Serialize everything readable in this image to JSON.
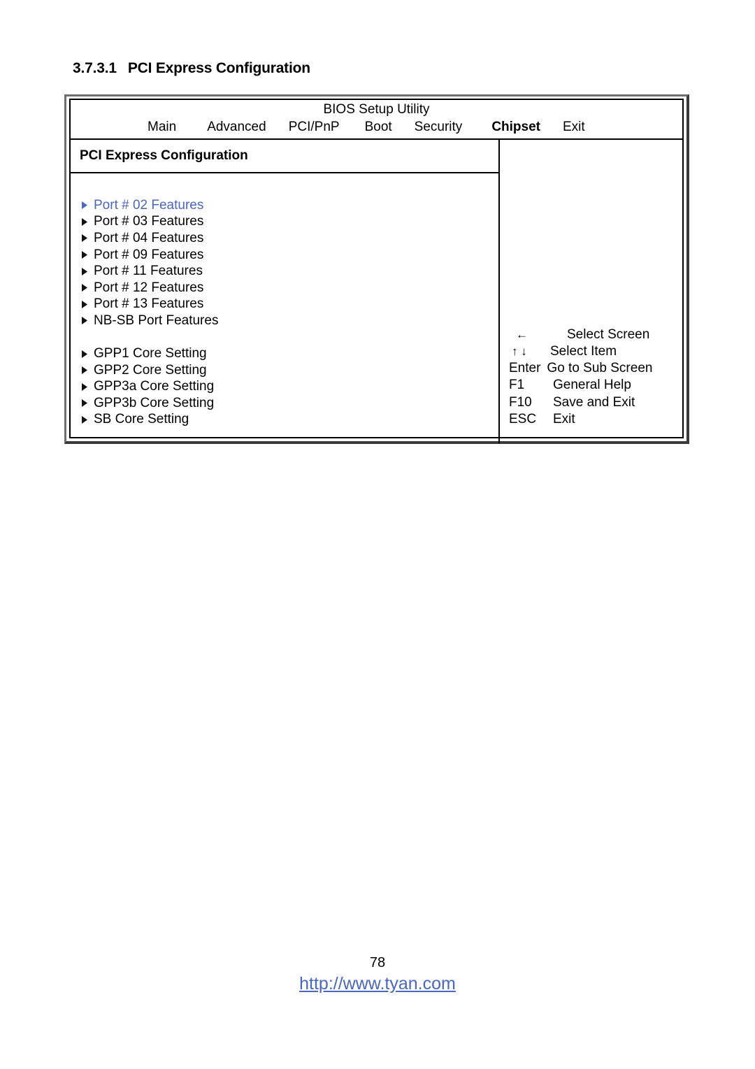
{
  "document": {
    "section_number": "3.7.3.1",
    "section_title": "PCI Express Configuration",
    "page_number": "78",
    "footer_url": "http://www.tyan.com"
  },
  "bios": {
    "utility_title": "BIOS Setup Utility",
    "tabs": [
      {
        "label": "Main",
        "active": false
      },
      {
        "label": "Advanced",
        "active": false
      },
      {
        "label": "PCI/PnP",
        "active": false
      },
      {
        "label": "Boot",
        "active": false
      },
      {
        "label": "Security",
        "active": false
      },
      {
        "label": "Chipset",
        "active": true
      },
      {
        "label": "Exit",
        "active": false
      }
    ],
    "pane_title": "PCI Express Configuration",
    "menu_group_1": [
      {
        "label": "Port # 02 Features",
        "selected": true
      },
      {
        "label": "Port # 03 Features",
        "selected": false
      },
      {
        "label": "Port # 04 Features",
        "selected": false
      },
      {
        "label": "Port # 09 Features",
        "selected": false
      },
      {
        "label": "Port # 11 Features",
        "selected": false
      },
      {
        "label": "Port # 12 Features",
        "selected": false
      },
      {
        "label": "Port # 13 Features",
        "selected": false
      },
      {
        "label": "NB-SB Port Features",
        "selected": false
      }
    ],
    "menu_group_2": [
      {
        "label": "GPP1 Core Setting",
        "selected": false
      },
      {
        "label": "GPP2 Core Setting",
        "selected": false
      },
      {
        "label": "GPP3a Core Setting",
        "selected": false
      },
      {
        "label": "GPP3b Core Setting",
        "selected": false
      },
      {
        "label": "SB Core Setting",
        "selected": false
      }
    ],
    "help_keys": [
      {
        "keys": "←",
        "label": "Select Screen"
      },
      {
        "keys": "↑ ↓",
        "label": "Select Item"
      },
      {
        "keys": "Enter",
        "label": "Go to Sub Screen"
      },
      {
        "keys": "F1",
        "label": "General Help"
      },
      {
        "keys": "F10",
        "label": "Save and Exit"
      },
      {
        "keys": "ESC",
        "label": "Exit"
      }
    ]
  },
  "colors": {
    "selected_blue": "#4a66c0",
    "link_blue": "#4a66c0",
    "frame_dark": "#3a3a3a",
    "frame_light": "#6e6e6e"
  }
}
